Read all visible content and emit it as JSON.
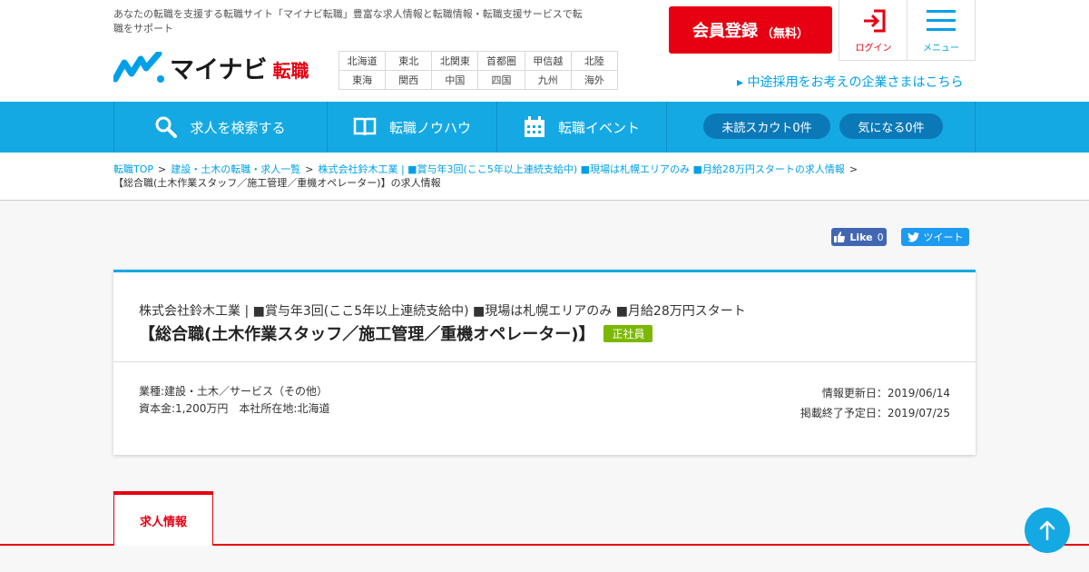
{
  "header": {
    "tagline": "あなたの転職を支援する転職サイト「マイナビ転職」豊富な求人情報と転職情報・転職支援サービスで転職をサポート",
    "logo_text": "マイナビ",
    "logo_sub": "転職",
    "regions": [
      [
        "北海道",
        "東北",
        "北関東",
        "首都圏",
        "甲信越",
        "北陸"
      ],
      [
        "東海",
        "関西",
        "中国",
        "四国",
        "九州",
        "海外"
      ]
    ],
    "signup_main": "会員登録",
    "signup_sub": "（無料）",
    "login_label": "ログイン",
    "menu_label": "メニュー",
    "corp_link": "▸ 中途採用をお考えの企業さまはこちら"
  },
  "nav": {
    "search": "求人を検索する",
    "knowhow": "転職ノウハウ",
    "event": "転職イベント",
    "scout": "未読スカウト0件",
    "favorite": "気になる0件"
  },
  "breadcrumb": {
    "items": [
      "転職TOP",
      "建設・土木の転職・求人一覧",
      "株式会社鈴木工業 | ■賞与年3回(ここ5年以上連続支給中) ■現場は札幌エリアのみ ■月給28万円スタートの求人情報"
    ],
    "current": "【総合職(土木作業スタッフ／施工管理／重機オペレーター)】の求人情報"
  },
  "social": {
    "fb_label": "Like",
    "fb_count": "0",
    "tw_label": "ツイート"
  },
  "job": {
    "company_line": "株式会社鈴木工業 | ■賞与年3回(ここ5年以上連続支給中) ■現場は札幌エリアのみ ■月給28万円スタート",
    "title": "【総合職(土木作業スタッフ／施工管理／重機オペレーター)】",
    "employment_type": "正社員",
    "industry": "業種:建設・土木／サービス（その他）",
    "capital_location": "資本金:1,200万円　本社所在地:北海道",
    "updated": "情報更新日：2019/06/14",
    "end_date": "掲載終了予定日：2019/07/25"
  },
  "tabs": {
    "job_info": "求人情報"
  },
  "colors": {
    "brand_red": "#e60012",
    "nav_blue": "#15a9e3",
    "tag_green": "#7cb800"
  }
}
